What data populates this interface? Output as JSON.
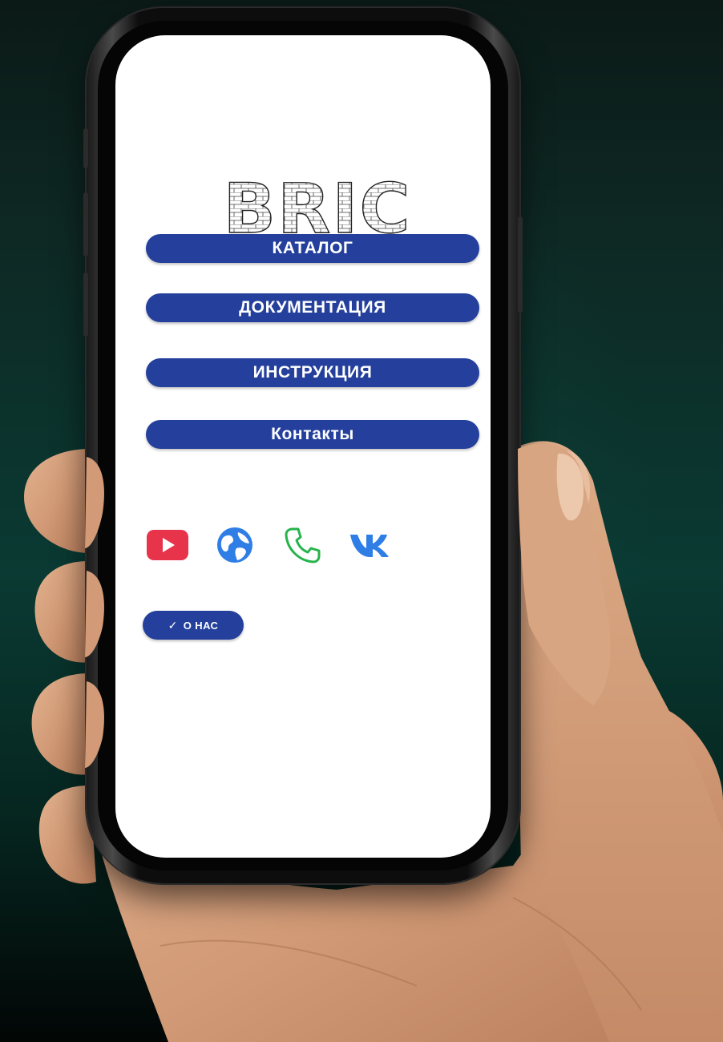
{
  "app": {
    "logo_text": "BRIC"
  },
  "menu": {
    "items": [
      {
        "label": "КАТАЛОГ"
      },
      {
        "label": "ДОКУМЕНТАЦИЯ"
      },
      {
        "label": "ИНСТРУКЦИЯ"
      },
      {
        "label": "Контакты"
      }
    ]
  },
  "social": {
    "icons": [
      {
        "name": "youtube-icon",
        "color": "#e8344a"
      },
      {
        "name": "globe-icon",
        "color": "#2f7ee6"
      },
      {
        "name": "phone-icon",
        "color": "#27b34b"
      },
      {
        "name": "vk-icon",
        "color": "#2f7ee6"
      }
    ]
  },
  "about": {
    "check": "✓",
    "label": "О НАС"
  },
  "colors": {
    "accent": "#24409c",
    "screen": "#ffffff"
  }
}
